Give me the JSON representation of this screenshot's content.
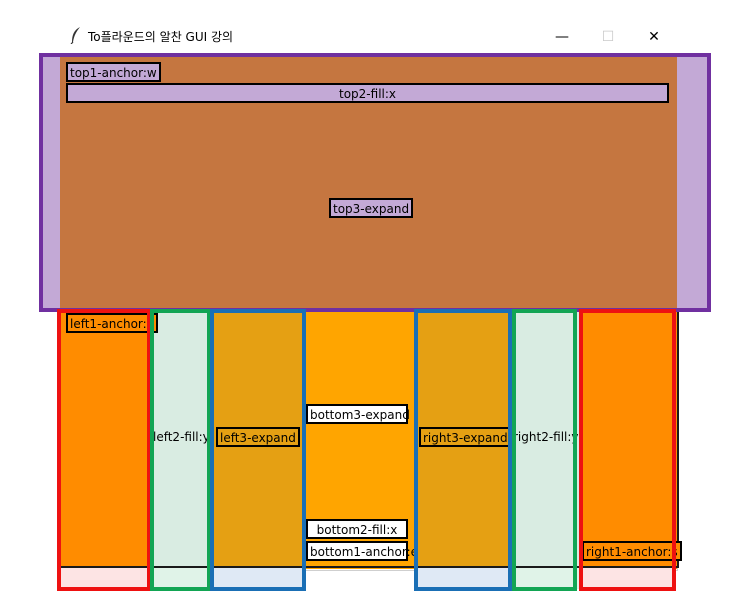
{
  "window": {
    "title": "To플라운드의 알찬 GUI 강의",
    "controls": {
      "minimize": "—",
      "maximize": "☐",
      "close": "✕"
    }
  },
  "labels": {
    "top1": "top1-anchor:w",
    "top2": "top2-fill:x",
    "top3": "top3-expand",
    "left1": "left1-anchor:n",
    "left2": "left2-fill:y",
    "left3": "left3-expand",
    "bottom3": "bottom3-expand",
    "bottom2": "bottom2-fill:x",
    "bottom1": "bottom1-anchor:e",
    "right3": "right3-expand",
    "right2": "right2-fill:y",
    "right1": "right1-anchor:s"
  },
  "colors": {
    "top_region": "#c57640",
    "top_label": "#c3a9d6",
    "left_orange": "#ff8c00",
    "expand_gold": "#e5a013",
    "center_orange": "#ffa500",
    "mint": "#d9ece2",
    "outline_purple": "#7030a0",
    "outline_red": "#ee1111",
    "outline_green": "#12a554",
    "outline_blue": "#1a6fb5",
    "pink_strip": "#fde4e4",
    "mint_strip": "#e0f3e8",
    "blue_strip": "#dfe9f5"
  }
}
